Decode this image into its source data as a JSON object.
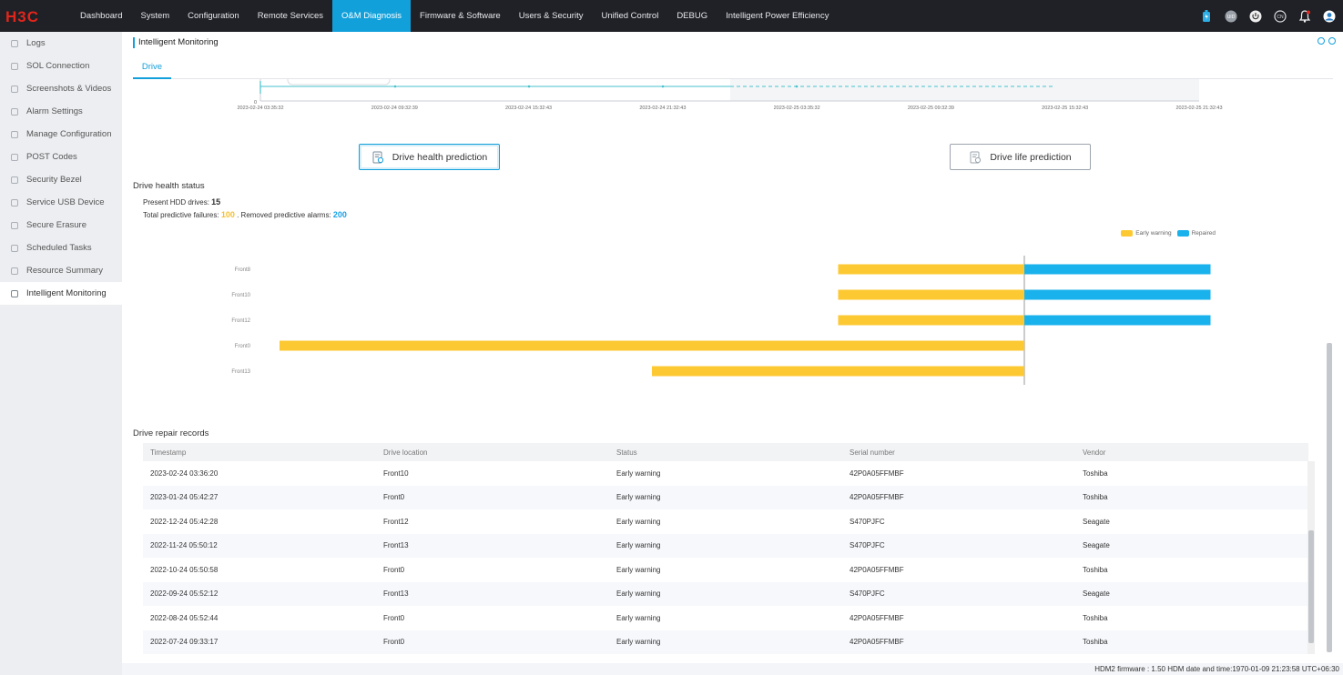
{
  "brand": {
    "logo_text": "H3C"
  },
  "nav": {
    "items": [
      "Dashboard",
      "System",
      "Configuration",
      "Remote Services",
      "O&M Diagnosis",
      "Firmware & Software",
      "Users & Security",
      "Unified Control",
      "DEBUG",
      "Intelligent Power Efficiency"
    ],
    "active": "O&M Diagnosis",
    "icons": [
      "battery-icon",
      "uid-icon",
      "power-icon",
      "language-icon",
      "bell-icon",
      "user-icon"
    ]
  },
  "sidebar": {
    "items": [
      "Logs",
      "SOL Connection",
      "Screenshots & Videos",
      "Alarm Settings",
      "Manage Configuration",
      "POST Codes",
      "Security Bezel",
      "Service USB Device",
      "Secure Erasure",
      "Scheduled Tasks",
      "Resource Summary",
      "Intelligent Monitoring"
    ],
    "active": "Intelligent Monitoring"
  },
  "page": {
    "title": "Intelligent Monitoring",
    "tab": "Drive"
  },
  "timeline": {
    "y_tick": "0",
    "x_ticks": [
      "2023-02-24 03:35:32",
      "2023-02-24 09:32:39",
      "2023-02-24 15:32:43",
      "2023-02-24 21:32:43",
      "2023-02-25 03:35:32",
      "2023-02-25 09:32:39",
      "2023-02-25 15:32:43",
      "2023-02-25 21:32:43"
    ]
  },
  "buttons": {
    "health_prediction": "Drive health prediction",
    "life_prediction": "Drive life prediction"
  },
  "health": {
    "title": "Drive health status",
    "present_label": "Present HDD drives:",
    "present_value": "15",
    "failures_label": "Total predictive failures:",
    "failures_value": "100",
    "removed_label": ". Removed predictive alarms:",
    "removed_value": "200"
  },
  "colors": {
    "early_warning": "#fdc933",
    "repaired": "#1ab2ec",
    "accent": "#12a0db"
  },
  "chart_data": {
    "type": "bar",
    "orientation": "horizontal-diverging",
    "categories": [
      "Front8",
      "Front10",
      "Front12",
      "Front0",
      "Front13"
    ],
    "series": [
      {
        "name": "Early warning",
        "values": [
          -1,
          -1,
          -1,
          -4,
          -2
        ]
      },
      {
        "name": "Repaired",
        "values": [
          1,
          1,
          1,
          0,
          0
        ]
      }
    ],
    "legend_position": "top-right",
    "xlim": [
      -4,
      1
    ]
  },
  "repair": {
    "title": "Drive repair records",
    "columns": [
      "Timestamp",
      "Drive location",
      "Status",
      "Serial number",
      "Vendor"
    ],
    "rows": [
      [
        "2023-02-24 03:36:20",
        "Front10",
        "Early warning",
        "42P0A05FFMBF",
        "Toshiba"
      ],
      [
        "2023-01-24 05:42:27",
        "Front0",
        "Early warning",
        "42P0A05FFMBF",
        "Toshiba"
      ],
      [
        "2022-12-24 05:42:28",
        "Front12",
        "Early warning",
        "S470PJFC",
        "Seagate"
      ],
      [
        "2022-11-24 05:50:12",
        "Front13",
        "Early warning",
        "S470PJFC",
        "Seagate"
      ],
      [
        "2022-10-24 05:50:58",
        "Front0",
        "Early warning",
        "42P0A05FFMBF",
        "Toshiba"
      ],
      [
        "2022-09-24 05:52:12",
        "Front13",
        "Early warning",
        "S470PJFC",
        "Seagate"
      ],
      [
        "2022-08-24 05:52:44",
        "Front0",
        "Early warning",
        "42P0A05FFMBF",
        "Toshiba"
      ],
      [
        "2022-07-24 09:33:17",
        "Front0",
        "Early warning",
        "42P0A05FFMBF",
        "Toshiba"
      ]
    ]
  },
  "status": {
    "text": "HDM2 firmware : 1.50    HDM date and time:1970-01-09 21:23:58 UTC+06:30"
  }
}
